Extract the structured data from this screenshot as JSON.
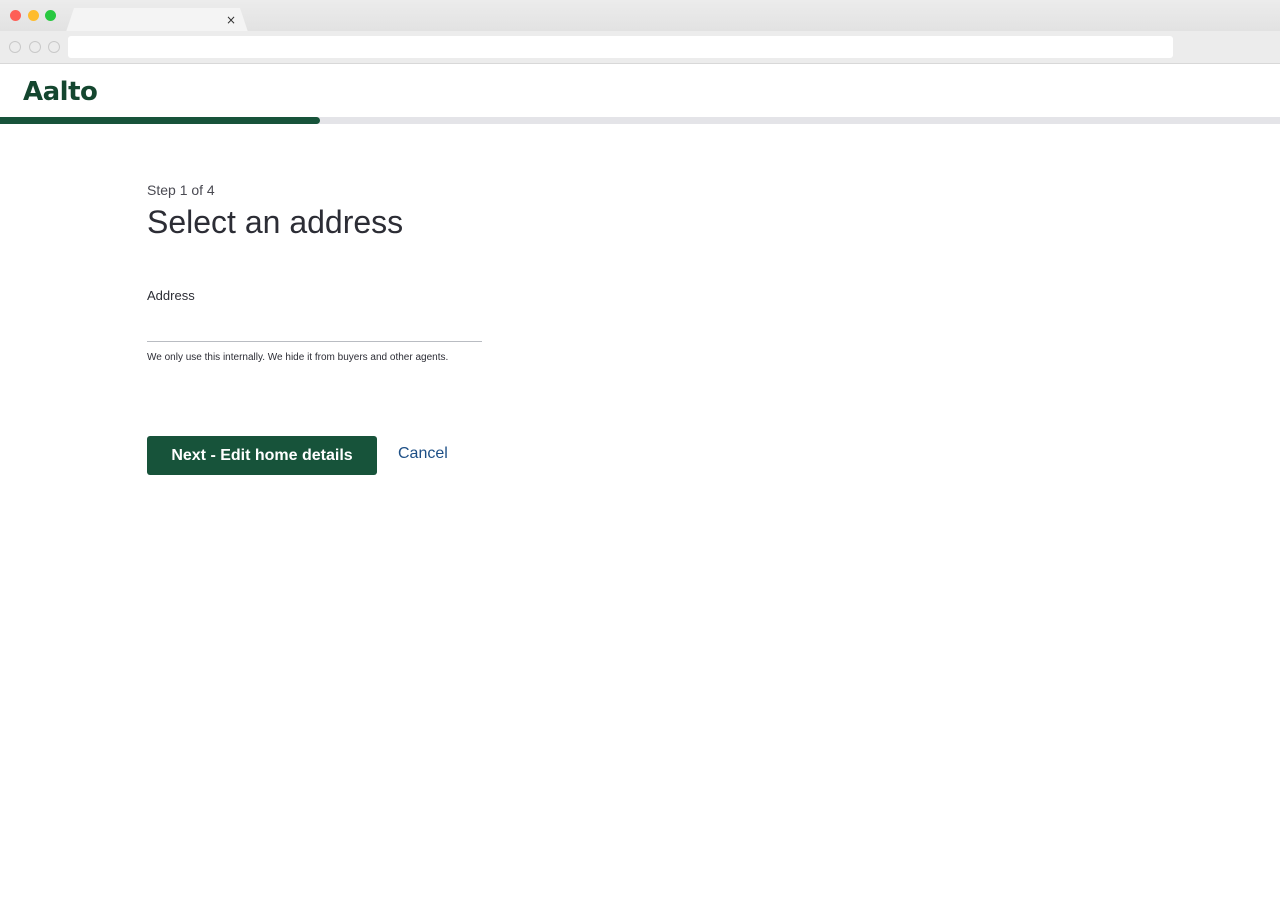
{
  "browser": {
    "close_glyph": "×",
    "address_value": ""
  },
  "header": {
    "logo": "Aalto"
  },
  "progress": {
    "fraction": 0.25,
    "color": "#17533a",
    "track_color": "#e4e4e8"
  },
  "form": {
    "step": "Step 1 of 4",
    "title": "Select an address",
    "address_label": "Address",
    "address_value": "",
    "address_placeholder": "",
    "hint": "We only use this internally. We hide it from buyers and other agents.",
    "next_label": "Next - Edit home details",
    "cancel_label": "Cancel"
  },
  "colors": {
    "brand": "#17533a",
    "link": "#1d4f86",
    "text": "#2c2d35"
  }
}
